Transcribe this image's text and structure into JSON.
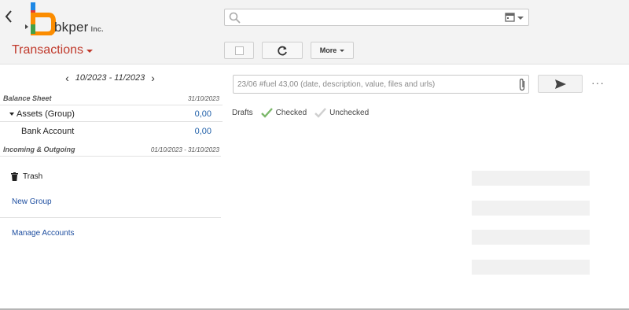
{
  "header": {
    "brand": "bkper",
    "brand_suffix": "Inc.",
    "back_icon": "chevron-left-icon",
    "search": {
      "placeholder": "",
      "value": ""
    },
    "search_icon": "search-icon",
    "calendar_icon": "calendar-icon"
  },
  "toolbar": {
    "title": "Transactions",
    "title_color": "#c0392b",
    "refresh_icon": "refresh-icon",
    "more_label": "More"
  },
  "sidebar": {
    "period": "10/2023 - 11/2023",
    "balance_sheet": {
      "label": "Balance Sheet",
      "date": "31/10/2023"
    },
    "groups": [
      {
        "label": "Assets (Group)",
        "value": "0,00"
      },
      {
        "label": "Bank Account",
        "value": "0,00"
      }
    ],
    "incoming_outgoing": {
      "label": "Incoming & Outgoing",
      "date": "01/10/2023 - 31/10/2023"
    },
    "trash_label": "Trash",
    "new_group_label": "New Group",
    "manage_accounts_label": "Manage Accounts",
    "link_color": "#1f4fa0"
  },
  "main": {
    "entry_placeholder": "23/06 #fuel 43,00 (date, description, value, files and urls)",
    "attach_icon": "paperclip-icon",
    "send_icon": "send-icon",
    "more_dots": "···",
    "filters": {
      "drafts": "Drafts",
      "checked": "Checked",
      "unchecked": "Unchecked",
      "checked_color": "#7cb86a",
      "unchecked_color": "#cfcfcf"
    }
  }
}
